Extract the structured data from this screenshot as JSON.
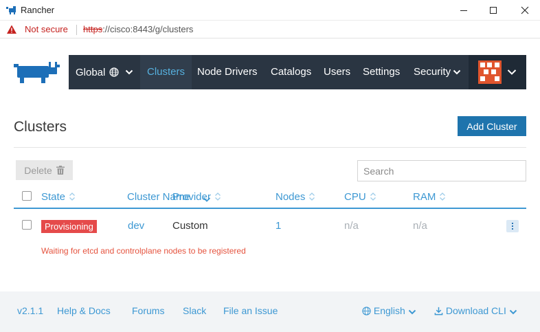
{
  "window": {
    "title": "Rancher",
    "app_icon": "rancher-icon",
    "controls": [
      "minimize-icon",
      "maximize-icon",
      "close-icon"
    ]
  },
  "address_bar": {
    "security_label": "Not secure",
    "url_scheme": "https",
    "url_rest": "://cisco:8443/g/clusters"
  },
  "nav": {
    "global_label": "Global",
    "items": [
      "Clusters",
      "Node Drivers",
      "Catalogs",
      "Users",
      "Settings",
      "Security"
    ],
    "active": "Clusters",
    "accent_color": "#56b0de",
    "bar_color": "#2a3542"
  },
  "page": {
    "title": "Clusters",
    "add_button": "Add Cluster",
    "delete_button": "Delete",
    "search_placeholder": "Search"
  },
  "table": {
    "columns": [
      "State",
      "Cluster Name",
      "Provider",
      "Nodes",
      "CPU",
      "RAM"
    ],
    "rows": [
      {
        "state": "Provisioning",
        "name": "dev",
        "provider": "Custom",
        "nodes": "1",
        "cpu": "n/a",
        "ram": "n/a",
        "message": "Waiting for etcd and controlplane nodes to be registered"
      }
    ],
    "state_color": "#e54a4a"
  },
  "footer": {
    "version": "v2.1.1",
    "help": "Help & Docs",
    "forums": "Forums",
    "slack": "Slack",
    "file_issue": "File an Issue",
    "language": "English",
    "download": "Download CLI"
  }
}
